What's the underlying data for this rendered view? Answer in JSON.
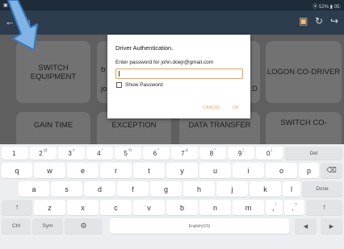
{
  "statusbar": {
    "left_text": "▣ ▣",
    "right_text": "⦿ 52% ▮ 05:"
  },
  "appbar": {
    "back_icon": "←",
    "title_fragment": "ns",
    "sync_icon": "▣",
    "refresh_icon": "↻",
    "logout_icon": "↪"
  },
  "tiles": {
    "switch_equipment": "SWITCH EQUIPMENT",
    "logon_codriver": "LOGON CO-DRIVER",
    "gain_time": "GAIN TIME",
    "exception": "EXCEPTION",
    "data_transfer": "DATA TRANSFER",
    "switch_co": "SWITCH CO-",
    "partial_b": "b",
    "partial_jo": "jo",
    "partial_d": "D"
  },
  "dialog": {
    "title": "Driver Authentication.",
    "prompt": "Enter password for john.doejr@gmail.com",
    "password_value": "",
    "show_password_label": "Show Password",
    "cancel_label": "CANCEL",
    "ok_label": "OK",
    "accent_color": "#f0a14a"
  },
  "keyboard": {
    "row1": [
      {
        "main": "1",
        "alt": "`"
      },
      {
        "main": "2",
        "alt": "@"
      },
      {
        "main": "3",
        "alt": "#"
      },
      {
        "main": "4",
        "alt": "/"
      },
      {
        "main": "5",
        "alt": "%"
      },
      {
        "main": "6",
        "alt": "^"
      },
      {
        "main": "7",
        "alt": "&"
      },
      {
        "main": "8",
        "alt": "*"
      },
      {
        "main": "9",
        "alt": "("
      },
      {
        "main": "0",
        "alt": ")"
      }
    ],
    "del_label": "Del",
    "row2": [
      "q",
      "w",
      "e",
      "r",
      "t",
      "y",
      "u",
      "i",
      "o",
      "p"
    ],
    "backspace_icon": "⌫",
    "row3": [
      "a",
      "s",
      "d",
      "f",
      "g",
      "h",
      "j",
      "k",
      "l"
    ],
    "done_label": "Done",
    "shift_icon": "↑",
    "row4": [
      "z",
      "x",
      "c",
      "v",
      "b",
      "n",
      "m"
    ],
    "comma_main": ",",
    "comma_alt": "!",
    "period_main": ".",
    "period_alt": "?",
    "ctrl_label": "Ctrl",
    "sym_label": "Sym",
    "settings_icon": "⚙",
    "space_label": "English(US)",
    "left_arrow_icon": "◀",
    "right_arrow_icon": "▶"
  }
}
